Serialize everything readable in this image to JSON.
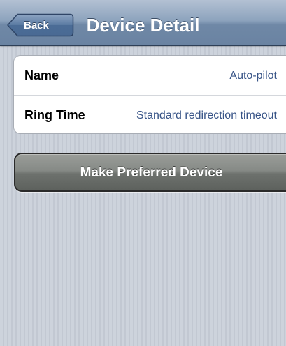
{
  "nav": {
    "title": "Device Detail",
    "back_label": "Back"
  },
  "details": {
    "rows": [
      {
        "label": "Name",
        "value": "Auto-pilot"
      },
      {
        "label": "Ring Time",
        "value": "Standard redirection timeout"
      }
    ]
  },
  "actions": {
    "preferred_label": "Make Preferred Device"
  },
  "icons": {
    "back": "back-arrow-icon"
  },
  "colors": {
    "nav_bar": "#7f96b3",
    "value_text": "#385487",
    "button": "#767a76",
    "background": "#c9cfd9"
  }
}
